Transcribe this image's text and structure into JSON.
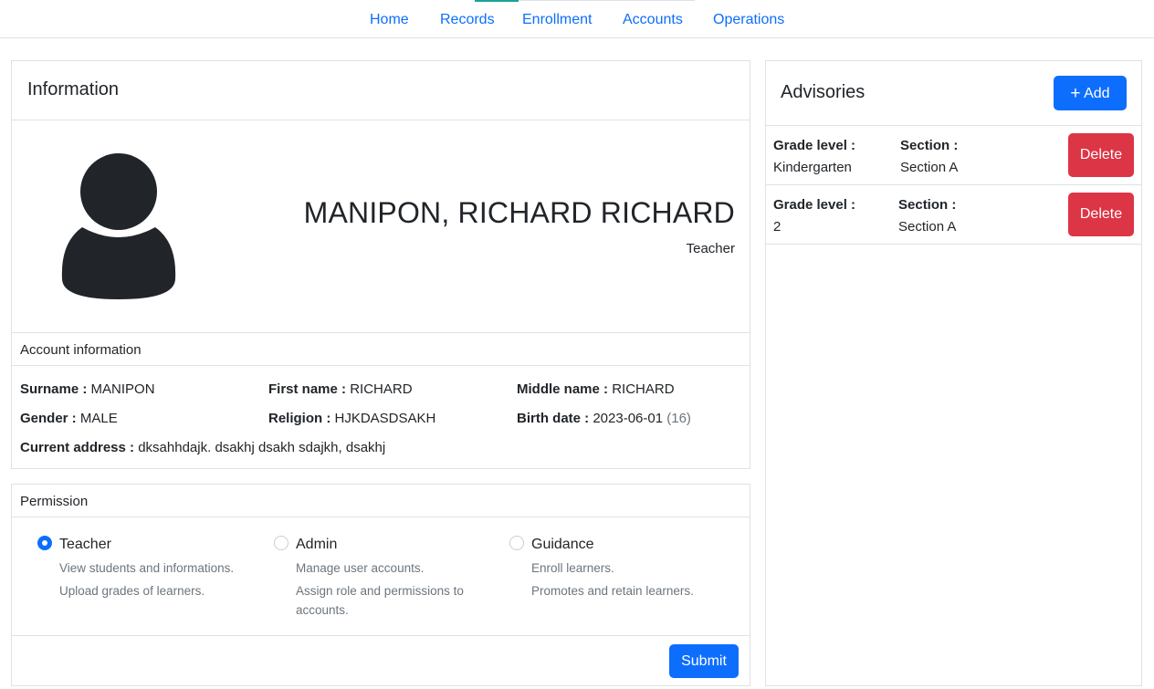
{
  "nav": {
    "items": [
      "Home",
      "Records",
      "Enrollment",
      "Accounts",
      "Operations"
    ]
  },
  "info": {
    "title": "Information",
    "full_name": "MANIPON, RICHARD RICHARD",
    "role": "Teacher",
    "account_section": "Account information",
    "surname_label": "Surname :",
    "surname": "MANIPON",
    "first_name_label": "First name :",
    "first_name": "RICHARD",
    "middle_name_label": "Middle name :",
    "middle_name": "RICHARD",
    "gender_label": "Gender :",
    "gender": "MALE",
    "religion_label": "Religion :",
    "religion": "HJKDASDSAKH",
    "birth_date_label": "Birth date :",
    "birth_date": "2023-06-01",
    "age": "(16)",
    "address_label": "Current address :",
    "address": "dksahhdajk. dsakhj dsakh sdajkh, dsakhj"
  },
  "permission": {
    "title": "Permission",
    "options": [
      {
        "label": "Teacher",
        "selected": true,
        "desc": [
          "View students and informations.",
          "Upload grades of learners."
        ]
      },
      {
        "label": "Admin",
        "selected": false,
        "desc": [
          "Manage user accounts.",
          "Assign role and permissions to accounts."
        ]
      },
      {
        "label": "Guidance",
        "selected": false,
        "desc": [
          "Enroll learners.",
          "Promotes and retain learners."
        ]
      }
    ],
    "submit_label": "Submit"
  },
  "advisories": {
    "title": "Advisories",
    "add_label": "Add",
    "grade_label": "Grade level :",
    "section_label": "Section :",
    "delete_label": "Delete",
    "rows": [
      {
        "grade": "Kindergarten",
        "section": "Section A"
      },
      {
        "grade": "2",
        "section": "Section A"
      }
    ]
  },
  "colors": {
    "primary": "#0d6efd",
    "danger": "#dc3545",
    "border": "#dee2e6"
  }
}
